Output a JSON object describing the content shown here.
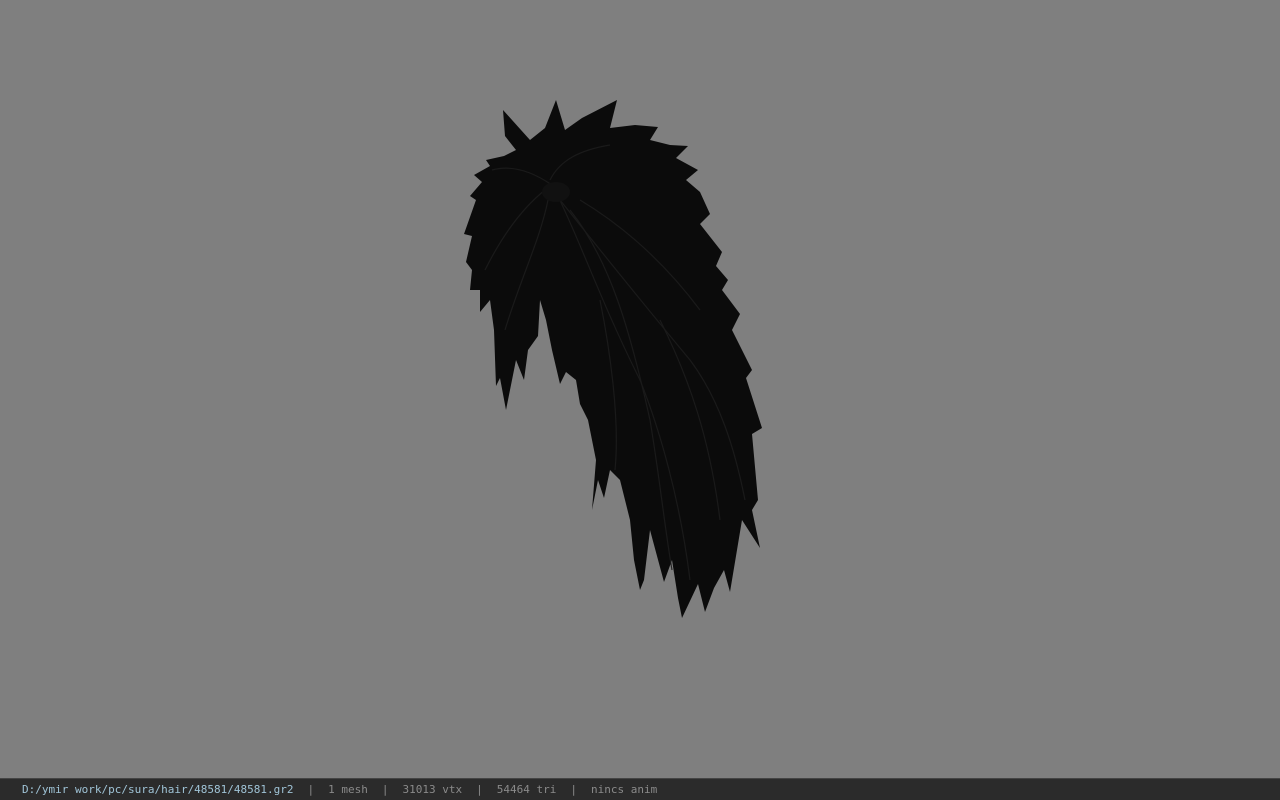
{
  "viewer": {
    "background_color": "#7f7f7f",
    "model_color": "#0b0b0b"
  },
  "status_bar": {
    "file_path": "D:/ymir work/pc/sura/hair/48581/48581.gr2",
    "separator": "|",
    "mesh_count": "1 mesh",
    "vertex_count": "31013 vtx",
    "triangle_count": "54464 tri",
    "anim_status": "nincs anim"
  }
}
